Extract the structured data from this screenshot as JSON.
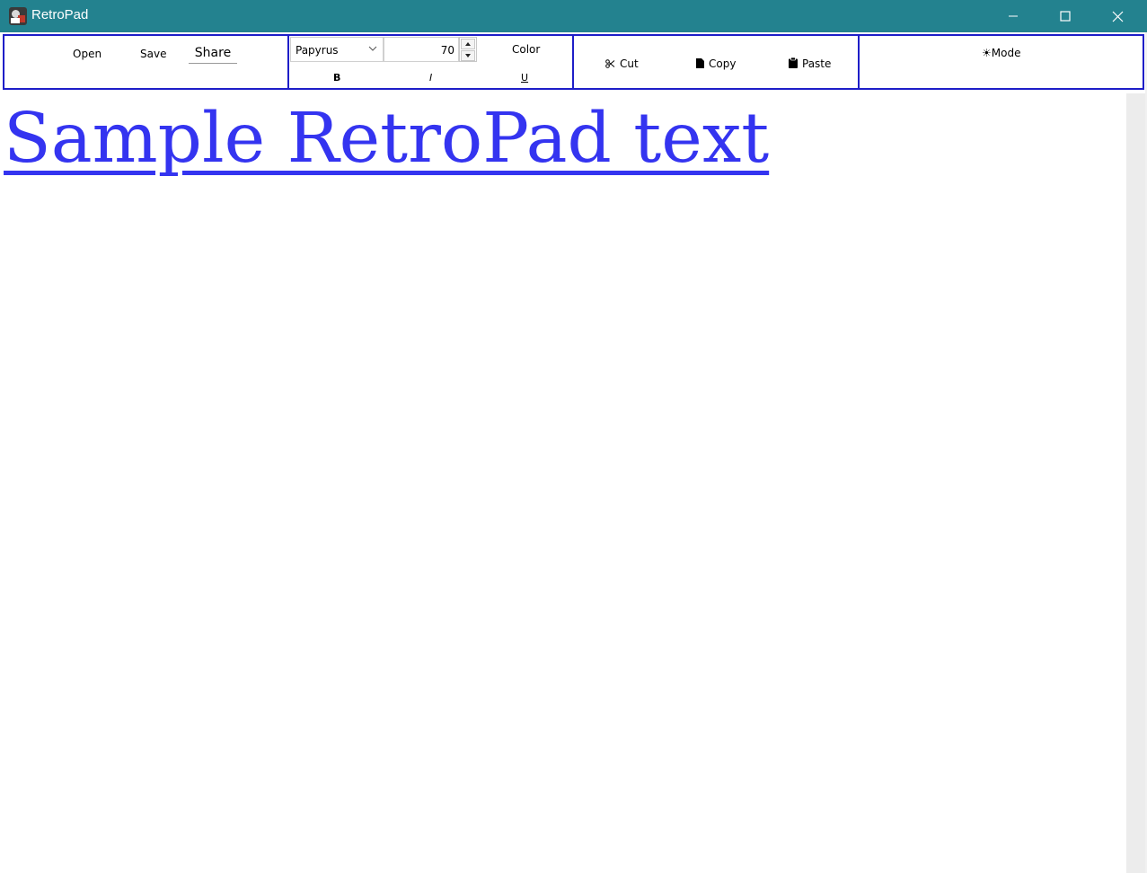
{
  "window": {
    "title": "RetroPad",
    "app_icon": "app-icon",
    "controls": [
      "minimize-icon",
      "maximize-icon",
      "close-icon"
    ]
  },
  "toolbar": {
    "file": {
      "open_label": "Open",
      "save_label": "Save",
      "share_label": "Share"
    },
    "format": {
      "font_family": "Papyrus",
      "font_size": "70",
      "color_label": "Color",
      "bold_label": "B",
      "italic_label": "I",
      "underline_label": "U"
    },
    "edit": {
      "cut_label": "Cut",
      "copy_label": "Copy",
      "paste_label": "Paste",
      "cut_icon": "scissors-icon",
      "copy_icon": "document-icon",
      "paste_icon": "clipboard-icon"
    },
    "view": {
      "mode_label": "☀Mode"
    }
  },
  "document": {
    "text": "Sample RetroPad text",
    "text_color": "#3434f0",
    "underlined": true
  },
  "colors": {
    "titlebar": "#23828f",
    "group_border": "#1e1ec8"
  }
}
